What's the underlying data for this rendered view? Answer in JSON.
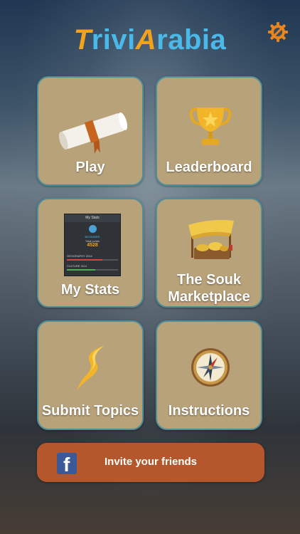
{
  "app": {
    "logo_t": "T",
    "logo_rivi": "rivi",
    "logo_a": "A",
    "logo_rabia": "rabia"
  },
  "icons": {
    "settings": "gear-wrench-icon",
    "play": "scroll-icon",
    "leaderboard": "trophy-icon",
    "stats": "stats-screen-thumbnail",
    "souk": "market-stall-icon",
    "submit": "lightning-s-icon",
    "instructions": "compass-icon",
    "facebook": "facebook-icon"
  },
  "tiles": {
    "play": "Play",
    "leaderboard": "Leaderboard",
    "stats": "My Stats",
    "souk_line1": "The Souk",
    "souk_line2": "Marketplace",
    "submit": "Submit Topics",
    "instructions": "Instructions"
  },
  "stats_preview": {
    "title": "My Stats",
    "rank": "BEGINNER",
    "points_label": "Total points",
    "points": "4528",
    "row1_label": "GEOGRAPHY",
    "row1_value": "2014",
    "row2_label": "CULTURE",
    "row2_value": "1114"
  },
  "invite": {
    "fb_letter": "f",
    "label": "Invite your friends"
  },
  "colors": {
    "tile": "#b8a27a",
    "tile_border": "#4f8f9a",
    "invite": "#b5572c",
    "accent_orange": "#f2a21d",
    "accent_blue": "#4ab8e8",
    "facebook": "#3b5998"
  }
}
